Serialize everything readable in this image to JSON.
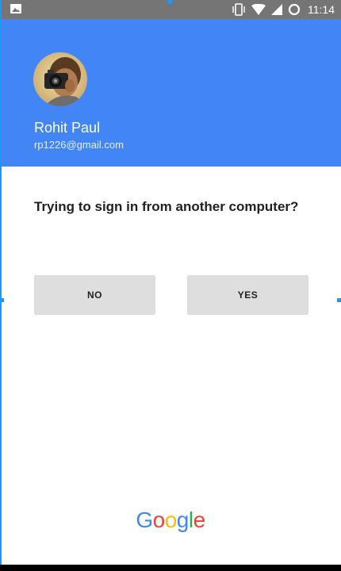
{
  "status_bar": {
    "time": "11:14",
    "icons": [
      "image-icon",
      "vibrate-icon",
      "wifi-icon",
      "signal-icon",
      "data-saver-icon"
    ]
  },
  "account": {
    "name": "Rohit Paul",
    "email": "rp1226@gmail.com"
  },
  "prompt": {
    "question": "Trying to sign in from another computer?",
    "no_label": "NO",
    "yes_label": "YES"
  },
  "branding": {
    "letters": [
      "G",
      "o",
      "o",
      "g",
      "l",
      "e"
    ],
    "letter_colors": [
      "#4285f4",
      "#ea4335",
      "#fbbc05",
      "#4285f4",
      "#34a853",
      "#ea4335"
    ]
  },
  "colors": {
    "header_bg": "#4285f4",
    "status_bar_bg": "#757575",
    "button_bg": "#dedede"
  }
}
